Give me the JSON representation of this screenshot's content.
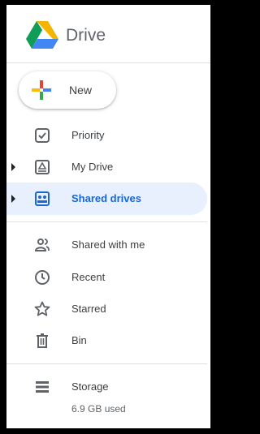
{
  "app": {
    "title": "Drive"
  },
  "new_button": {
    "label": "New"
  },
  "nav": {
    "priority": "Priority",
    "my_drive": "My Drive",
    "shared_drives": "Shared drives",
    "shared_with_me": "Shared with me",
    "recent": "Recent",
    "starred": "Starred",
    "bin": "Bin"
  },
  "storage": {
    "label": "Storage",
    "used": "6.9 GB used"
  },
  "active_item": "Shared drives",
  "colors": {
    "active_bg": "#e8f0fe",
    "active_text": "#1967d2",
    "icon_gray": "#5f6368",
    "drive_green": "#0f9d58",
    "drive_blue": "#4285f4",
    "drive_yellow": "#f4b400",
    "drive_red": "#db4437"
  }
}
